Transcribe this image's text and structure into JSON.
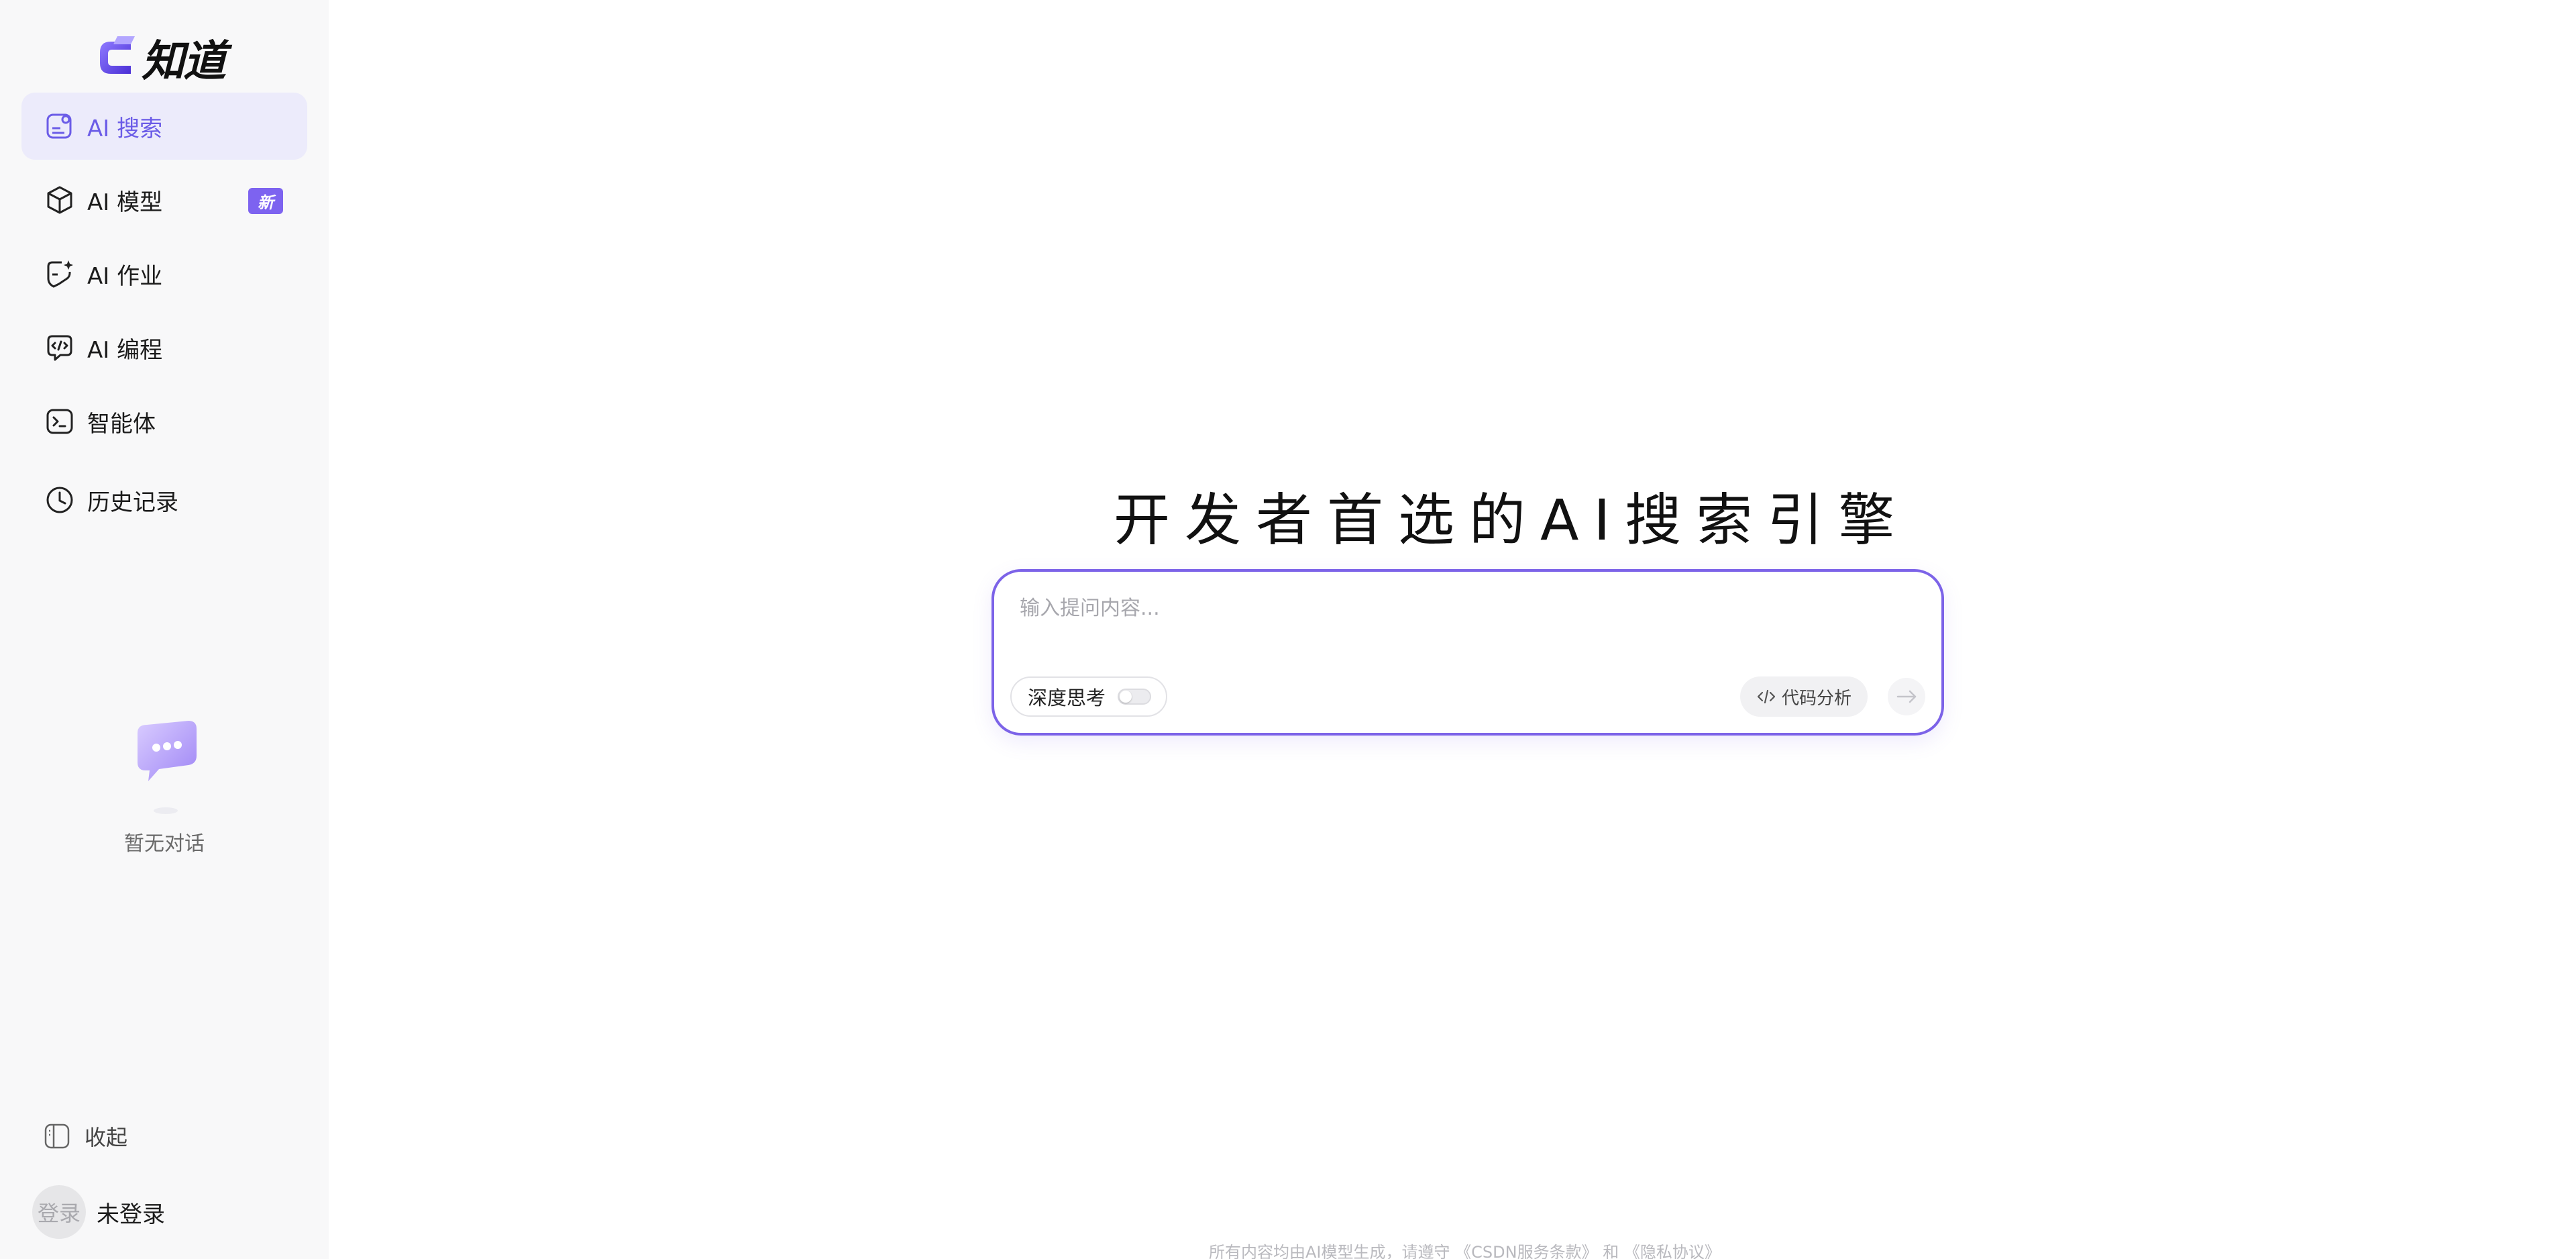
{
  "brand": {
    "name": "知道"
  },
  "sidebar": {
    "items": [
      {
        "label": "AI 搜索",
        "icon": "ai-search-icon",
        "active": true
      },
      {
        "label": "AI 模型",
        "icon": "cube-icon",
        "badge": "新"
      },
      {
        "label": "AI 作业",
        "icon": "homework-icon"
      },
      {
        "label": "AI 编程",
        "icon": "code-chat-icon"
      },
      {
        "label": "智能体",
        "icon": "terminal-icon"
      },
      {
        "label": "历史记录",
        "icon": "clock-icon"
      }
    ],
    "empty_text": "暂无对话",
    "collapse_label": "收起",
    "avatar_text": "登录",
    "user_label": "未登录"
  },
  "main": {
    "title": "开发者首选的AI搜索引擎",
    "input_placeholder": "输入提问内容...",
    "deep_think_label": "深度思考",
    "code_analysis_label": "代码分析"
  },
  "footer": {
    "prefix": "所有内容均由AI模型生成，请遵守",
    "terms": "《CSDN服务条款》",
    "and": "和",
    "privacy": "《隐私协议》"
  },
  "colors": {
    "accent": "#7c63e8",
    "active_bg": "#ecebfb",
    "sidebar_bg": "#f8f8f9"
  }
}
